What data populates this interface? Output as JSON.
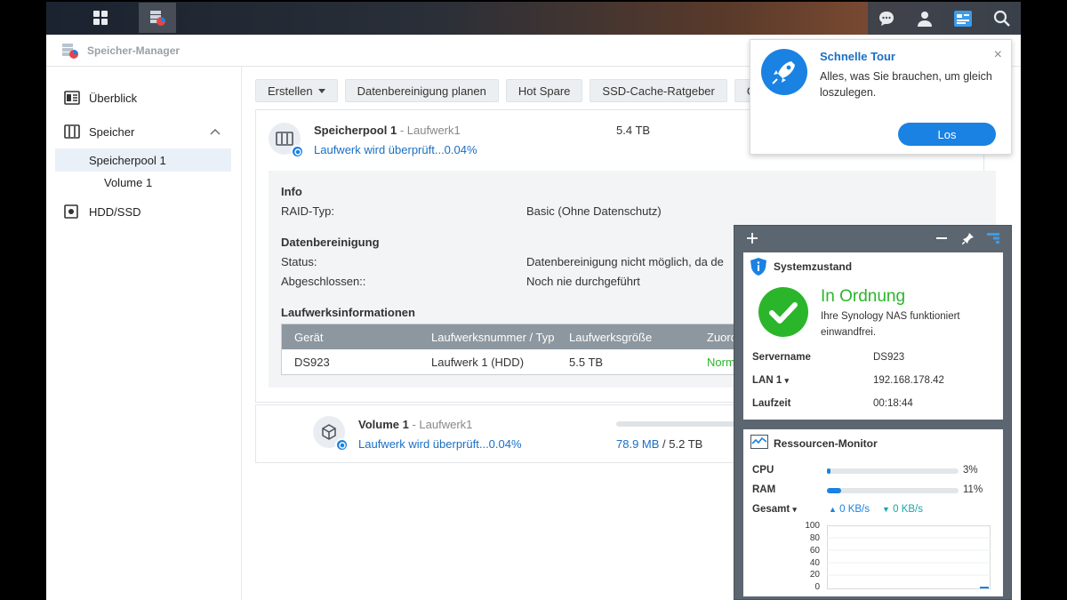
{
  "app": {
    "title": "Speicher-Manager"
  },
  "sidebar": {
    "items": [
      {
        "label": "Überblick"
      },
      {
        "label": "Speicher"
      },
      {
        "label": "Speicherpool 1"
      },
      {
        "label": "Volume 1"
      },
      {
        "label": "HDD/SSD"
      }
    ]
  },
  "toolbar": {
    "create_label": "Erstellen",
    "scrub_label": "Datenbereinigung planen",
    "hotspare_label": "Hot Spare",
    "ssd_label": "SSD-Cache-Ratgeber",
    "more_label": "G"
  },
  "pool": {
    "name": "Speicherpool 1",
    "sub": " - Laufwerk1",
    "status": "Laufwerk wird überprüft...0.04%",
    "size": "5.4 TB",
    "info_heading": "Info",
    "raid_label": "RAID-Typ:",
    "raid_value": "Basic (Ohne Datenschutz)",
    "scrub_heading": "Datenbereinigung",
    "status_label": "Status:",
    "status_value": "Datenbereinigung nicht möglich, da de",
    "done_label": "Abgeschlossen::",
    "done_value": "Noch nie durchgeführt",
    "drive_heading": "Laufwerksinformationen",
    "table": {
      "headers": [
        "Gerät",
        "Laufwerksnummer / Typ",
        "Laufwerksgröße",
        "Zuord"
      ],
      "row": [
        "DS923",
        "Laufwerk 1 (HDD)",
        "5.5 TB",
        "Norm"
      ]
    }
  },
  "volume": {
    "name": "Volume 1",
    "sub": " - Laufwerk1",
    "status": "Laufwerk wird überprüft...0.04%",
    "used": "78.9 MB",
    "total": " / 5.2 TB",
    "used_fraction": 0.0
  },
  "tour": {
    "title": "Schnelle Tour",
    "text": "Alles, was Sie brauchen, um gleich loszulegen.",
    "button": "Los",
    "close": "×"
  },
  "widget": {
    "health": {
      "title": "Systemzustand",
      "state": "In Ordnung",
      "desc": "Ihre Synology NAS funktioniert einwandfrei.",
      "server_label": "Servername",
      "server_value": "DS923",
      "lan_label": "LAN 1",
      "lan_value": "192.168.178.42",
      "uptime_label": "Laufzeit",
      "uptime_value": "00:18:44"
    },
    "monitor": {
      "title": "Ressourcen-Monitor",
      "cpu_label": "CPU",
      "cpu_value": "3%",
      "cpu_fraction": 0.03,
      "ram_label": "RAM",
      "ram_value": "11%",
      "ram_fraction": 0.11,
      "total_label": "Gesamt",
      "up_value": "0 KB/s",
      "down_value": "0 KB/s",
      "y_ticks": [
        "100",
        "80",
        "60",
        "40",
        "20",
        "0"
      ]
    }
  },
  "colors": {
    "accent": "#1a82e2",
    "ok": "#2bb52b",
    "link": "#1a6fc4"
  }
}
